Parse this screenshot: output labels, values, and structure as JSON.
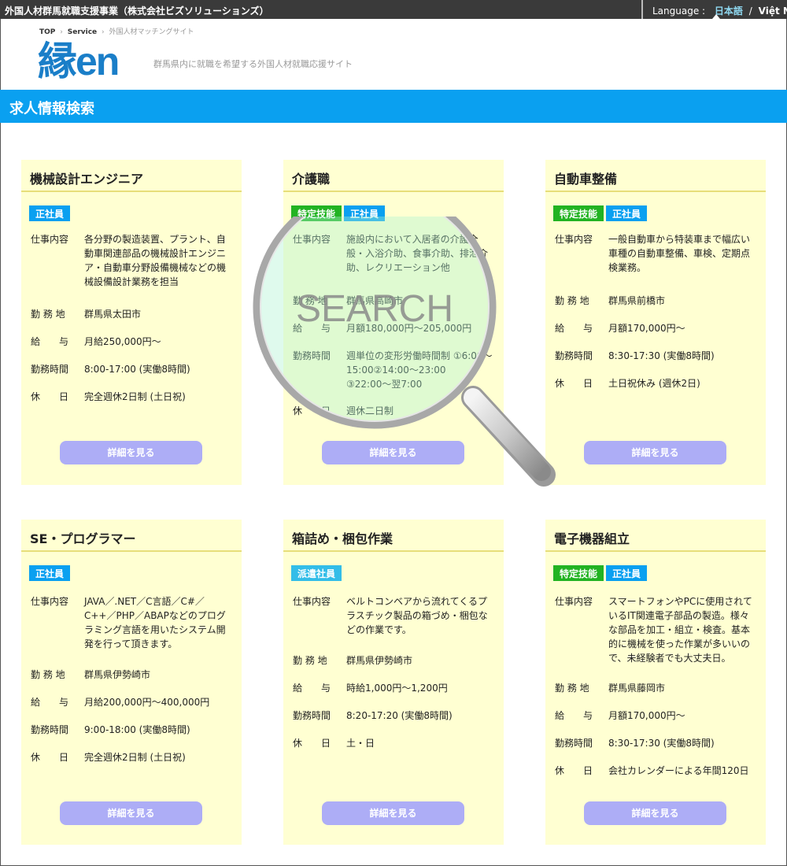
{
  "topbar": {
    "site_title": "外国人材群馬就職支援事業（株式会社ビズソリューションズ）",
    "language_label": "Language :",
    "language_ja": "日本語",
    "language_sep": "/",
    "language_vi": "Việt Nam"
  },
  "breadcrumb": {
    "top": "TOP",
    "service": "Service",
    "current": "外国人材マッチングサイト"
  },
  "logo_text": "縁en",
  "tagline": "群馬県内に就職を希望する外国人材就職応援サイト",
  "page_title": "求人情報検索",
  "magnifier_text": "SEARCH",
  "detail_button_label": "詳細を見る",
  "colors": {
    "accent": "#0aa0f0",
    "card_bg": "#ffffd2",
    "button": "#adadf6",
    "tag_green": "#22b322"
  },
  "jobs": [
    {
      "title": "機械設計エンジニア",
      "tags": [
        {
          "label": "正社員",
          "style": "blue"
        }
      ],
      "rows": [
        {
          "label": "仕事内容",
          "value": "各分野の製造装置、プラント、自動車関連部品の機械設計エンジニア・自動車分野設備機械などの機械設備設計業務を担当"
        },
        {
          "label": "勤 務 地",
          "value": "群馬県太田市"
        },
        {
          "label": "給　　与",
          "value": "月給250,000円〜"
        },
        {
          "label": "勤務時間",
          "value": "8:00-17:00 (実働8時間)"
        },
        {
          "label": "休　　日",
          "value": "完全週休2日制 (土日祝)"
        }
      ]
    },
    {
      "title": "介護職",
      "tags": [
        {
          "label": "特定技能",
          "style": "green"
        },
        {
          "label": "正社員",
          "style": "blue"
        }
      ],
      "rows": [
        {
          "label": "仕事内容",
          "value": "施設内において入居者の介護全般・入浴介助、食事介助、排泄介助、レクリエーション他"
        },
        {
          "label": "勤 務 地",
          "value": "群馬県高崎市"
        },
        {
          "label": "給　　与",
          "value": "月額180,000円〜205,000円"
        },
        {
          "label": "勤務時間",
          "value": "週単位の変形労働時間制 ①6:00〜15:00②14:00〜23:00 ③22:00〜翌7:00"
        },
        {
          "label": "休　　日",
          "value": "週休二日制"
        }
      ]
    },
    {
      "title": "自動車整備",
      "tags": [
        {
          "label": "特定技能",
          "style": "green"
        },
        {
          "label": "正社員",
          "style": "blue"
        }
      ],
      "rows": [
        {
          "label": "仕事内容",
          "value": "一般自動車から特装車まで幅広い車種の自動車整備、車検、定期点検業務。"
        },
        {
          "label": "勤 務 地",
          "value": "群馬県前橋市"
        },
        {
          "label": "給　　与",
          "value": "月額170,000円〜"
        },
        {
          "label": "勤務時間",
          "value": "8:30-17:30 (実働8時間)"
        },
        {
          "label": "休　　日",
          "value": "土日祝休み (週休2日)"
        }
      ]
    },
    {
      "title": "SE・プログラマー",
      "tags": [
        {
          "label": "正社員",
          "style": "blue"
        }
      ],
      "rows": [
        {
          "label": "仕事内容",
          "value": " JAVA／.NET／C言語／C#／C++／PHP／ABAPなどのプログラミング言語を用いたシステム開発を行って頂きます。"
        },
        {
          "label": "勤 務 地",
          "value": "群馬県伊勢崎市"
        },
        {
          "label": "給　　与",
          "value": "月給200,000円〜400,000円"
        },
        {
          "label": "勤務時間",
          "value": "9:00-18:00 (実働8時間)"
        },
        {
          "label": "休　　日",
          "value": "完全週休2日制 (土日祝)"
        }
      ]
    },
    {
      "title": "箱詰め・梱包作業",
      "tags": [
        {
          "label": "派遣社員",
          "style": "cyan"
        }
      ],
      "rows": [
        {
          "label": "仕事内容",
          "value": "ベルトコンベアから流れてくるプラスチック製品の箱づめ・梱包などの作業です。"
        },
        {
          "label": "勤 務 地",
          "value": "群馬県伊勢崎市"
        },
        {
          "label": "給　　与",
          "value": "時給1,000円〜1,200円"
        },
        {
          "label": "勤務時間",
          "value": "8:20-17:20 (実働8時間)"
        },
        {
          "label": "休　　日",
          "value": "土・日"
        }
      ]
    },
    {
      "title": "電子機器組立",
      "tags": [
        {
          "label": "特定技能",
          "style": "green"
        },
        {
          "label": "正社員",
          "style": "blue"
        }
      ],
      "rows": [
        {
          "label": "仕事内容",
          "value": "スマートフォンやPCに使用されているIT関連電子部品の製造。様々な部品を加工・組立・検査。基本的に機械を使った作業が多いいので、未経験者でも大丈夫日。"
        },
        {
          "label": "勤 務 地",
          "value": "群馬県藤岡市"
        },
        {
          "label": "給　　与",
          "value": "月額170,000円〜"
        },
        {
          "label": "勤務時間",
          "value": "8:30-17:30 (実働8時間)"
        },
        {
          "label": "休　　日",
          "value": "会社カレンダーによる年間120日"
        }
      ]
    }
  ]
}
